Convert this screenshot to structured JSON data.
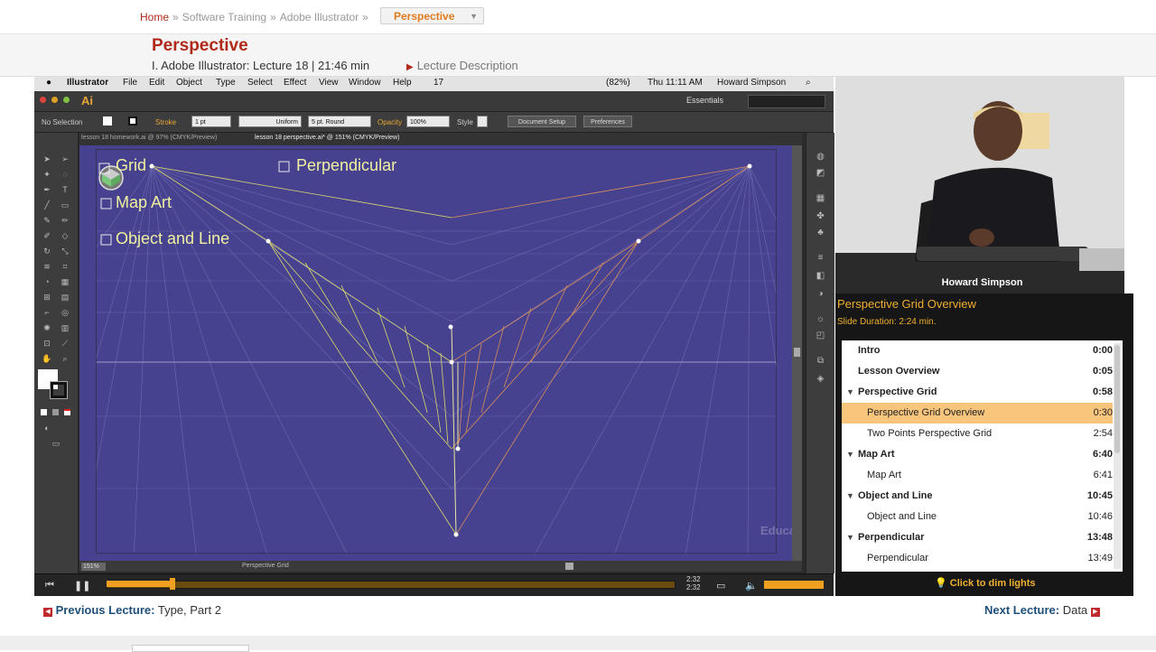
{
  "breadcrumb": {
    "home": "Home",
    "items": [
      "Software Training",
      "Adobe Illustrator"
    ],
    "separator": "»",
    "current": "Perspective"
  },
  "lecture": {
    "title": "Perspective",
    "info": "I. Adobe Illustrator: Lecture 18 | 21:46 min",
    "description_link": "Lecture Description"
  },
  "mac_menubar": {
    "items": [
      "Illustrator",
      "File",
      "Edit",
      "Object",
      "Type",
      "Select",
      "Effect",
      "View",
      "Window",
      "Help"
    ],
    "battery": "(82%)",
    "clock": "Thu 11:11 AM",
    "user": "Howard Simpson",
    "badge_count": "17"
  },
  "ai_app": {
    "logo": "Ai",
    "workspace": "Essentials",
    "control_bar": {
      "selection": "No Selection",
      "stroke_label": "Stroke",
      "stroke_weight": "1 pt",
      "profile": "Uniform",
      "brush": "5 pt. Round",
      "opacity_label": "Opacity",
      "opacity_value": "100%",
      "style_label": "Style",
      "document_setup": "Document Setup",
      "preferences": "Preferences"
    },
    "doc_tabs": [
      "lesson 18 homework.ai @ 97% (CMYK/Preview)",
      "lesson 18 perspective.ai* @ 151% (CMYK/Preview)"
    ],
    "zoom": "151%",
    "status_label": "Perspective Grid"
  },
  "canvas": {
    "labels": [
      "Grid",
      "Perpendicular",
      "Map Art",
      "Object and Line"
    ],
    "watermark": "Educator"
  },
  "player": {
    "time_current": "2:32",
    "time_total": "2:32",
    "progress": 0.12
  },
  "instructor": {
    "name": "Howard Simpson"
  },
  "slide": {
    "title": "Perspective Grid Overview",
    "duration": "Slide Duration: 2:24 min."
  },
  "lessons": [
    {
      "label": "Intro",
      "time": "0:00",
      "level": "header",
      "expandable": false
    },
    {
      "label": "Lesson Overview",
      "time": "0:05",
      "level": "header",
      "expandable": false
    },
    {
      "label": "Perspective Grid",
      "time": "0:58",
      "level": "header",
      "expandable": true
    },
    {
      "label": "Perspective Grid Overview",
      "time": "0:30",
      "level": "sub",
      "active": true
    },
    {
      "label": "Two Points Perspective Grid",
      "time": "2:54",
      "level": "sub"
    },
    {
      "label": "Map Art",
      "time": "6:40",
      "level": "header",
      "expandable": true
    },
    {
      "label": "Map Art",
      "time": "6:41",
      "level": "sub"
    },
    {
      "label": "Object and Line",
      "time": "10:45",
      "level": "header",
      "expandable": true
    },
    {
      "label": "Object and Line",
      "time": "10:46",
      "level": "sub"
    },
    {
      "label": "Perpendicular",
      "time": "13:48",
      "level": "header",
      "expandable": true
    },
    {
      "label": "Perpendicular",
      "time": "13:49",
      "level": "sub"
    }
  ],
  "dim_lights": "Click to dim lights",
  "nav": {
    "previous_label": "Previous Lecture:",
    "previous_title": "Type, Part 2",
    "next_label": "Next Lecture:",
    "next_title": "Data"
  },
  "colors": {
    "brand_red": "#b02a1a",
    "accent_orange": "#f0a020",
    "canvas_blue": "#47428f",
    "active_row": "#f8c57d"
  }
}
